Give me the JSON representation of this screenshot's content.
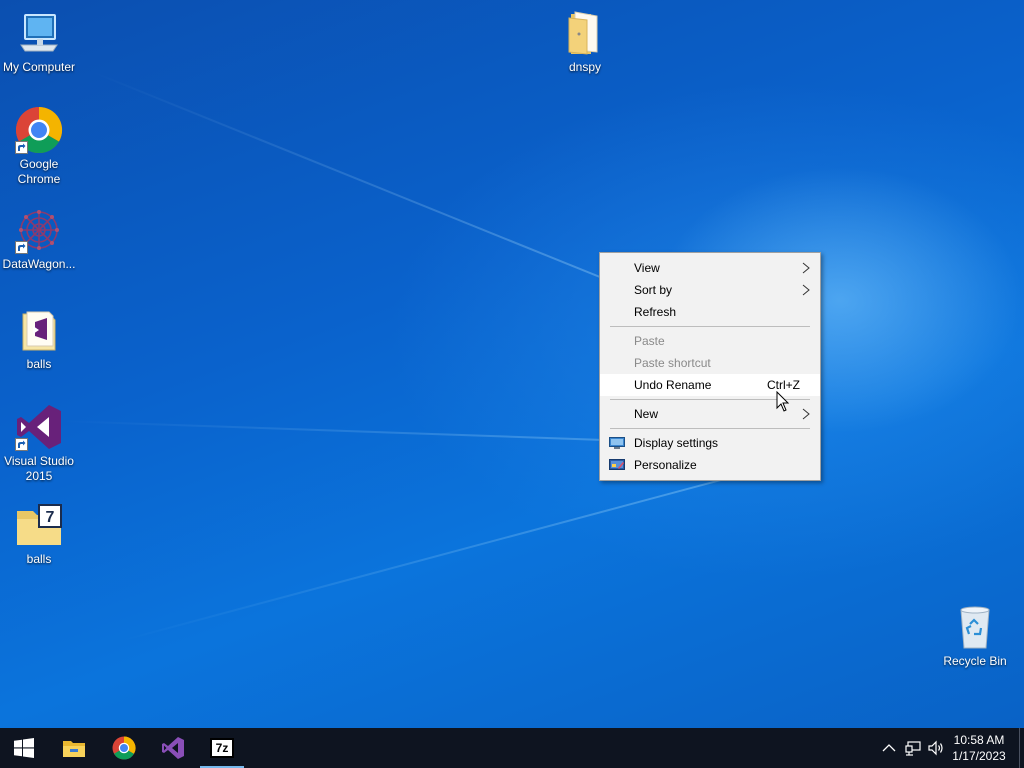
{
  "desktop": {
    "icons": [
      {
        "label": "My Computer",
        "icon": "computer-icon",
        "shortcut": false
      },
      {
        "label": "Google Chrome",
        "icon": "chrome-icon",
        "shortcut": true
      },
      {
        "label": "DataWagon...",
        "icon": "datawagon-icon",
        "shortcut": true
      },
      {
        "label": "balls",
        "icon": "vs-solution-file-icon",
        "shortcut": false
      },
      {
        "label": "Visual Studio 2015",
        "icon": "visual-studio-icon",
        "shortcut": true
      },
      {
        "label": "balls",
        "icon": "7zip-archive-icon",
        "shortcut": false
      },
      {
        "label": "dnspy",
        "icon": "folder-icon",
        "shortcut": false
      },
      {
        "label": "Recycle Bin",
        "icon": "recycle-bin-icon",
        "shortcut": false
      }
    ]
  },
  "context_menu": {
    "items": [
      {
        "label": "View",
        "submenu": true,
        "enabled": true
      },
      {
        "label": "Sort by",
        "submenu": true,
        "enabled": true
      },
      {
        "label": "Refresh",
        "enabled": true
      },
      {
        "label": "Paste",
        "enabled": false
      },
      {
        "label": "Paste shortcut",
        "enabled": false
      },
      {
        "label": "Undo Rename",
        "shortcut": "Ctrl+Z",
        "enabled": true,
        "highlighted": true
      },
      {
        "label": "New",
        "submenu": true,
        "enabled": true
      },
      {
        "label": "Display settings",
        "icon": "display-icon",
        "enabled": true
      },
      {
        "label": "Personalize",
        "icon": "personalize-icon",
        "enabled": true
      }
    ]
  },
  "taskbar": {
    "buttons": [
      {
        "name": "start",
        "icon": "windows-logo-icon"
      },
      {
        "name": "file-explorer",
        "icon": "folder-icon"
      },
      {
        "name": "chrome",
        "icon": "chrome-icon"
      },
      {
        "name": "visual-studio",
        "icon": "visual-studio-icon"
      },
      {
        "name": "7zip",
        "icon": "7zip-icon",
        "active": true,
        "text": "7z"
      }
    ],
    "tray": {
      "time": "10:58 AM",
      "date": "1/17/2023"
    }
  },
  "colors": {
    "taskbar_bg": "#0e1420",
    "menu_bg": "#f2f2f2",
    "vs_purple": "#68217a",
    "active_indicator": "#76b9ed"
  }
}
